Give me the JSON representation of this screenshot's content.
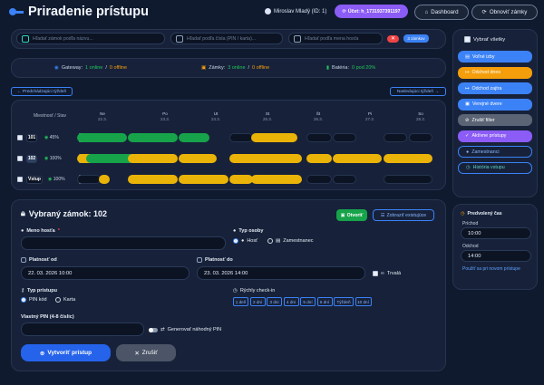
{
  "header": {
    "title": "Priradenie prístupu",
    "user": "Miroslav Mladý (ID: 1)",
    "account": "Účet: h_1731937391197",
    "dashboard": "Dashboard",
    "refresh_locks": "Obnoviť zámky"
  },
  "filters": {
    "lock_search_placeholder": "Hľadať zámok podľa názvu...",
    "number_search_placeholder": "Hľadať podľa čísla (PIN / karta)...",
    "guest_search_placeholder": "Hľadať podľa mena hosťa",
    "clear": "✕",
    "count_label": "3 zámkov"
  },
  "status": {
    "gateway_label": "Gateway:",
    "gateway_online": "1 online",
    "gateway_sep": "/",
    "gateway_offline": "0 offline",
    "locks_label": "Zámky:",
    "locks_online": "3 online",
    "locks_sep": "/",
    "locks_offline": "0 offline",
    "battery_label": "Batéria:",
    "battery_value": "0 pod 20%"
  },
  "week_nav": {
    "prev": "← Predchádzajúci týždeň",
    "next": "Nasledujúci týždeň →"
  },
  "calendar": {
    "room_status_header": "Miestnosť / Stav",
    "days": [
      {
        "name": "Ne",
        "date": "22.3."
      },
      {
        "name": "Po",
        "date": "23.3."
      },
      {
        "name": "Ut",
        "date": "24.3."
      },
      {
        "name": "St",
        "date": "25.3."
      },
      {
        "name": "Št",
        "date": "26.3."
      },
      {
        "name": "Pi",
        "date": "27.3."
      },
      {
        "name": "So",
        "date": "28.3."
      }
    ],
    "rows": [
      {
        "name": "101",
        "battery": "45%"
      },
      {
        "name": "102",
        "battery": "100%"
      },
      {
        "name": "Vstup",
        "battery": "100%"
      }
    ]
  },
  "form": {
    "title": "Vybraný zámok: 102",
    "open_btn": "Otvoriť",
    "show_existing_btn": "Zobraziť existujúce",
    "guest_name_label": "Meno hosťa",
    "required_mark": "*",
    "guest_name_value": "",
    "person_type_label": "Typ osoby",
    "person_type_guest": "Hosť",
    "person_type_employee": "Zamestnanec",
    "valid_from_label": "Platnosť od",
    "valid_from_value": "22. 03. 2026 10:00",
    "valid_to_label": "Platnosť do",
    "valid_to_value": "23. 03. 2026 14:00",
    "permanent_label": "Trvalá",
    "access_type_label": "Typ prístupu",
    "access_pin": "PIN kód",
    "access_card": "Karta",
    "quick_checkin_label": "Rýchly check-in",
    "quick_options": [
      "1 deň",
      "2 dni",
      "3 dni",
      "4 dni",
      "5 dní",
      "6 dní",
      "Týždeň",
      "10 dní"
    ],
    "custom_pin_label": "Vlastný PIN (4-8 číslic)",
    "custom_pin_value": "",
    "generate_pin_label": "Generovať náhodný PIN",
    "create_btn": "Vytvoriť prístup",
    "cancel_btn": "Zrušiť"
  },
  "sidebar": {
    "select_all": "Vybrať všetky",
    "buttons": [
      {
        "label": "Voľné izby",
        "style": "blue"
      },
      {
        "label": "Odchod dnes",
        "style": "orange"
      },
      {
        "label": "Odchod zajtra",
        "style": "blue"
      },
      {
        "label": "Verejné dvere",
        "style": "blue"
      },
      {
        "label": "Zrušiť filter",
        "style": "gray"
      },
      {
        "label": "Aktívne prístupy",
        "style": "purple"
      },
      {
        "label": "Zamestnanci",
        "style": "outline"
      },
      {
        "label": "História vstupu",
        "style": "outline-teal"
      }
    ],
    "default_time_title": "Predvolený čas",
    "arrival_label": "Príchod",
    "arrival_value": "10:00",
    "departure_label": "Odchod",
    "departure_value": "14:00",
    "use_new_access": "Použiť sa pri novom prístupe"
  },
  "colors": {
    "background": "#0f1a2e",
    "accent_blue": "#3b82f6",
    "purple": "#8b5cf6",
    "green_slot": "#16a34a",
    "gold_slot": "#eab308",
    "orange": "#f59e0b"
  }
}
